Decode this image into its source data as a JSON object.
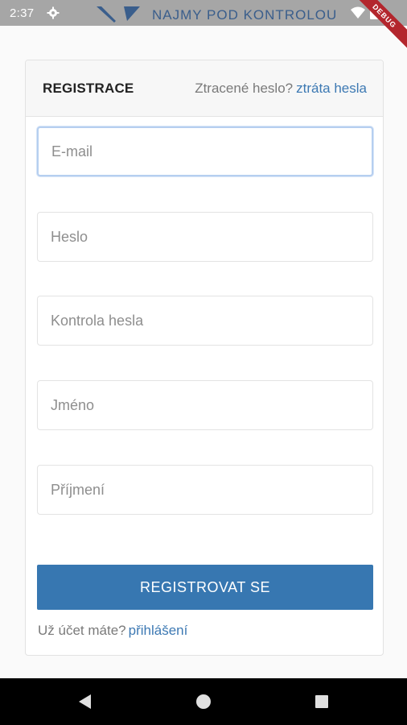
{
  "status_bar": {
    "time": "2:37",
    "gear_icon": "settings-gear-icon",
    "wifi_icon": "wifi-icon",
    "battery_icon": "battery-icon"
  },
  "brand": {
    "text": "NAJMY POD KONTROLOU"
  },
  "debug_ribbon": {
    "text": "DEBUG"
  },
  "card": {
    "title": "REGISTRACE",
    "lost_password_prompt": "Ztracené heslo?",
    "lost_password_link": "ztráta hesla"
  },
  "form": {
    "email": {
      "placeholder": "E-mail",
      "value": ""
    },
    "password": {
      "placeholder": "Heslo",
      "value": ""
    },
    "password_check": {
      "placeholder": "Kontrola hesla",
      "value": ""
    },
    "first_name": {
      "placeholder": "Jméno",
      "value": ""
    },
    "last_name": {
      "placeholder": "Příjmení",
      "value": ""
    },
    "submit_label": "REGISTROVAT SE"
  },
  "footer": {
    "account_prompt": "Už účet máte?",
    "login_link": "přihlášení"
  },
  "nav": {
    "back_icon": "back-triangle-icon",
    "home_icon": "home-circle-icon",
    "recents_icon": "recents-square-icon"
  },
  "colors": {
    "accent": "#3777b1",
    "link": "#3d79b3",
    "focus_border": "#b6cff0",
    "ribbon": "#b3262d"
  }
}
